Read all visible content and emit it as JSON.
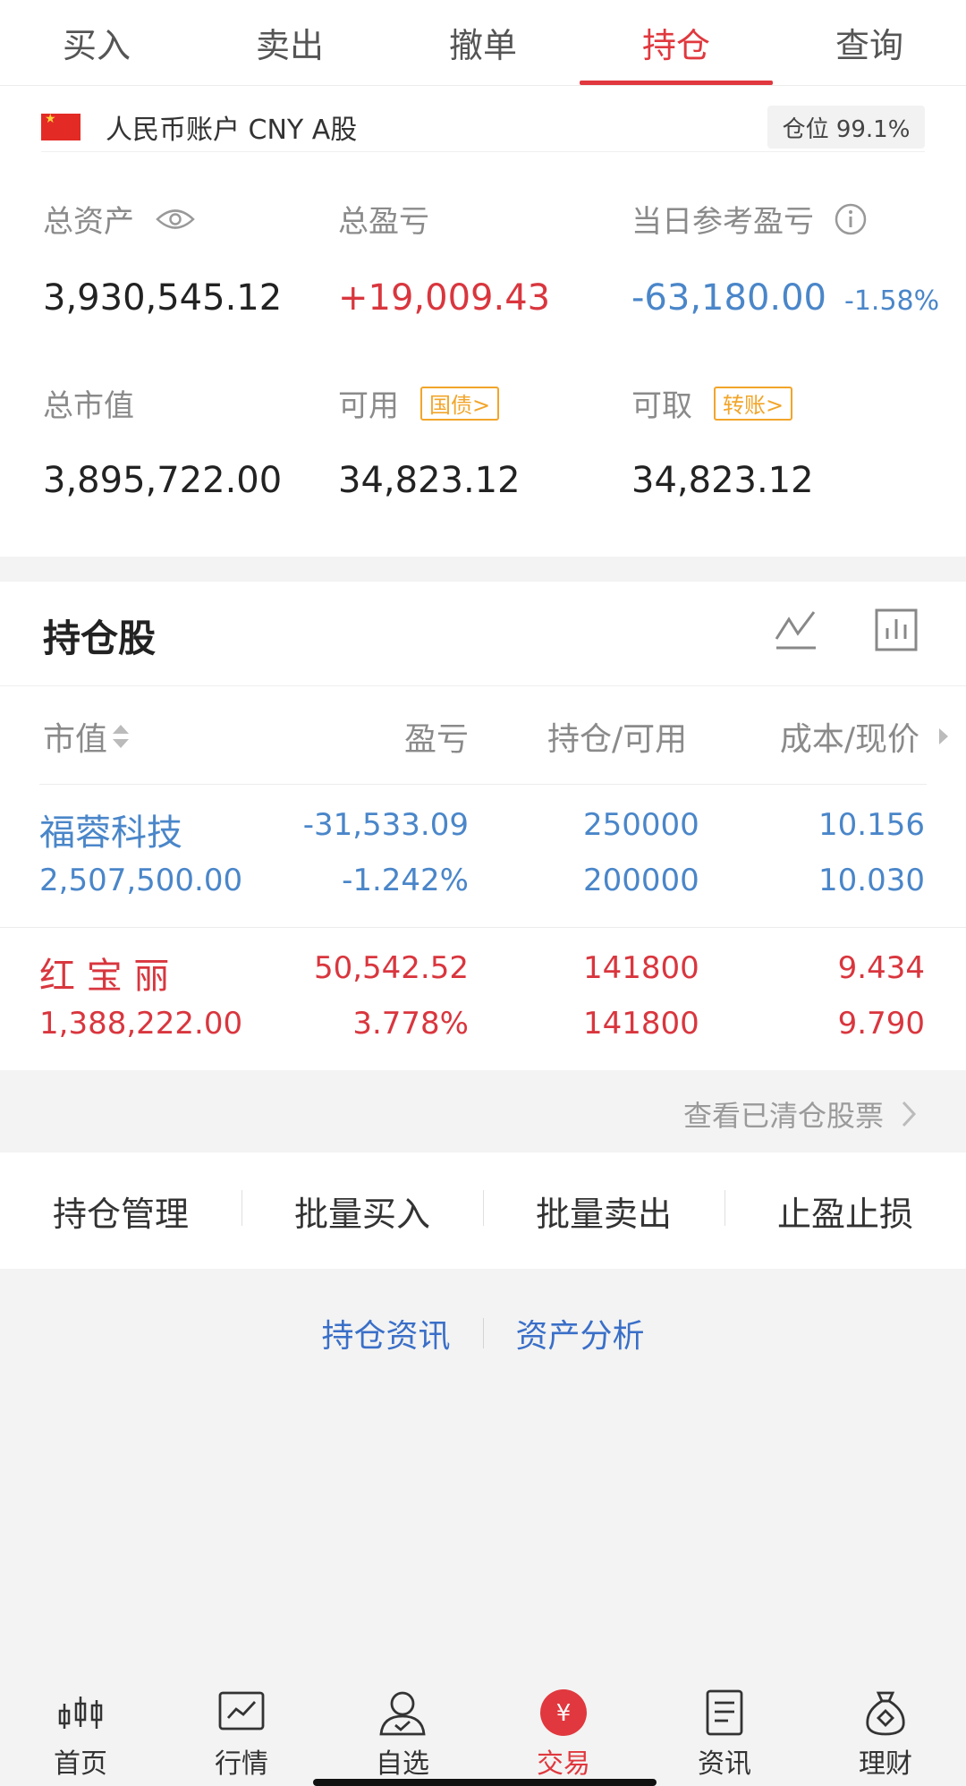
{
  "tabs": [
    {
      "label": "买入"
    },
    {
      "label": "卖出"
    },
    {
      "label": "撤单"
    },
    {
      "label": "持仓",
      "active": true
    },
    {
      "label": "查询"
    }
  ],
  "account": {
    "name": "人民币账户 CNY A股",
    "position_label": "仓位 99.1%"
  },
  "summary": {
    "total_assets_label": "总资产",
    "total_assets": "3,930,545.12",
    "total_pl_label": "总盈亏",
    "total_pl": "+19,009.43",
    "daily_pl_label": "当日参考盈亏",
    "daily_pl": "-63,180.00",
    "daily_pl_pct": "-1.58%",
    "market_value_label": "总市值",
    "market_value": "3,895,722.00",
    "available_label": "可用",
    "available_tag": "国债>",
    "available": "34,823.12",
    "withdrawable_label": "可取",
    "withdrawable_tag": "转账>",
    "withdrawable": "34,823.12"
  },
  "holdings": {
    "title": "持仓股",
    "columns": [
      "市值",
      "盈亏",
      "持仓/可用",
      "成本/现价"
    ],
    "rows": [
      {
        "name": "福蓉科技",
        "market_value": "2,507,500.00",
        "pl": "-31,533.09",
        "pl_pct": "-1.242%",
        "position": "250000",
        "available": "200000",
        "cost": "10.156",
        "price": "10.030",
        "color": "#4a86c9"
      },
      {
        "name": "红 宝 丽",
        "market_value": "1,388,222.00",
        "pl": "50,542.52",
        "pl_pct": "3.778%",
        "position": "141800",
        "available": "141800",
        "cost": "9.434",
        "price": "9.790",
        "color": "#d9363e"
      }
    ],
    "cleared_link": "查看已清仓股票"
  },
  "actions": [
    {
      "label": "持仓管理"
    },
    {
      "label": "批量买入"
    },
    {
      "label": "批量卖出"
    },
    {
      "label": "止盈止损"
    }
  ],
  "links": [
    {
      "label": "持仓资讯"
    },
    {
      "label": "资产分析"
    }
  ],
  "nav": [
    {
      "label": "首页",
      "icon": "candlestick-icon"
    },
    {
      "label": "行情",
      "icon": "line-chart-icon"
    },
    {
      "label": "自选",
      "icon": "user-check-icon"
    },
    {
      "label": "交易",
      "icon": "yuan-icon",
      "active": true
    },
    {
      "label": "资讯",
      "icon": "document-icon"
    },
    {
      "label": "理财",
      "icon": "money-bag-icon"
    }
  ],
  "colors": {
    "accent": "#e0383e",
    "down": "#4a86c9",
    "up": "#d9363e",
    "tag": "#f2a52a"
  }
}
